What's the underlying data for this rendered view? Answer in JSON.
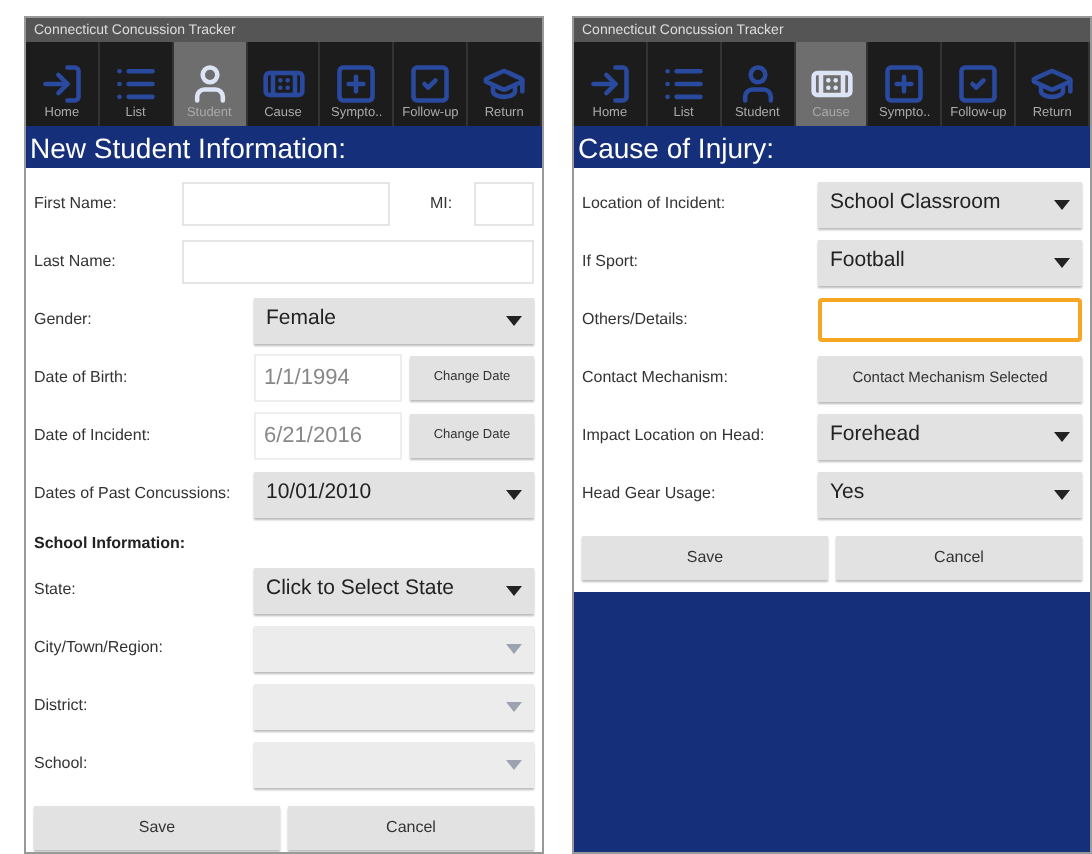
{
  "screens": [
    {
      "app_title": "Connecticut Concussion Tracker",
      "tabs": [
        {
          "label": "Home",
          "selected": false
        },
        {
          "label": "List",
          "selected": false
        },
        {
          "label": "Student",
          "selected": true
        },
        {
          "label": "Cause",
          "selected": false
        },
        {
          "label": "Sympto..",
          "selected": false
        },
        {
          "label": "Follow-up",
          "selected": false
        },
        {
          "label": "Return",
          "selected": false
        }
      ],
      "heading": "New Student Information:",
      "rows": [
        {
          "kind": "name_mi",
          "label": "First Name:",
          "second_label": "MI:"
        },
        {
          "kind": "text",
          "label": "Last Name:",
          "focused": false
        },
        {
          "kind": "select",
          "label": "Gender:",
          "value": "Female",
          "disabled": false
        },
        {
          "kind": "date",
          "label": "Date of Birth:",
          "value": "1/1/1994",
          "button": "Change Date"
        },
        {
          "kind": "date",
          "label": "Date of Incident:",
          "value": "6/21/2016",
          "button": "Change Date"
        },
        {
          "kind": "select",
          "label": "Dates of Past Concussions:",
          "value": "10/01/2010",
          "disabled": false
        },
        {
          "kind": "section",
          "label": "School Information:"
        },
        {
          "kind": "select",
          "label": "State:",
          "value": "Click to Select State",
          "disabled": false
        },
        {
          "kind": "select",
          "label": "City/Town/Region:",
          "disabled": true
        },
        {
          "kind": "select",
          "label": "District:",
          "disabled": true
        },
        {
          "kind": "select",
          "label": "School:",
          "disabled": true
        }
      ],
      "buttons": [
        "Save",
        "Cancel"
      ]
    },
    {
      "app_title": "Connecticut Concussion Tracker",
      "tabs": [
        {
          "label": "Home",
          "selected": false
        },
        {
          "label": "List",
          "selected": false
        },
        {
          "label": "Student",
          "selected": false
        },
        {
          "label": "Cause",
          "selected": true
        },
        {
          "label": "Sympto..",
          "selected": false
        },
        {
          "label": "Follow-up",
          "selected": false
        },
        {
          "label": "Return",
          "selected": false
        }
      ],
      "heading": "Cause of Injury:",
      "rows": [
        {
          "kind": "select",
          "label": "Location of Incident:",
          "value": "School Classroom",
          "disabled": false
        },
        {
          "kind": "select",
          "label": "If Sport:",
          "value": "Football",
          "disabled": false
        },
        {
          "kind": "text",
          "label": "Others/Details:",
          "focused": true
        },
        {
          "kind": "button",
          "label": "Contact Mechanism:",
          "button": "Contact Mechanism Selected"
        },
        {
          "kind": "select",
          "label": "Impact Location on Head:",
          "value": "Forehead",
          "disabled": false
        },
        {
          "kind": "select",
          "label": "Head Gear Usage:",
          "value": "Yes",
          "disabled": false
        }
      ],
      "buttons": [
        "Save",
        "Cancel"
      ]
    }
  ]
}
